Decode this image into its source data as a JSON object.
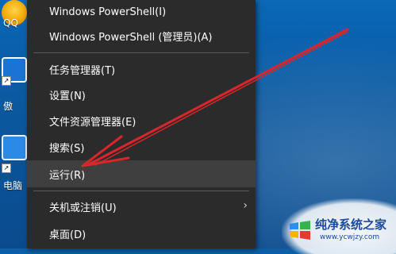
{
  "desktop": {
    "icons": [
      {
        "label": "QQ",
        "icon": "qq-icon"
      },
      {
        "label": "傲",
        "icon": "app-icon"
      },
      {
        "label": "电脑",
        "icon": "shield-icon"
      }
    ]
  },
  "menu": {
    "items": [
      {
        "label": "Windows PowerShell(I)"
      },
      {
        "label": "Windows PowerShell (管理员)(A)"
      },
      {
        "label": "任务管理器(T)"
      },
      {
        "label": "设置(N)"
      },
      {
        "label": "文件资源管理器(E)"
      },
      {
        "label": "搜索(S)"
      },
      {
        "label": "运行(R)"
      },
      {
        "label": "关机或注销(U)",
        "submenu_icon": "chevron-right-icon"
      },
      {
        "label": "桌面(D)"
      }
    ],
    "highlighted": "运行(R)"
  },
  "annotation": {
    "color": "#d9262a",
    "icon": "red-arrow"
  },
  "watermark": {
    "title": "纯净系统之家",
    "subtitle": "www.ycwjzy.com"
  }
}
